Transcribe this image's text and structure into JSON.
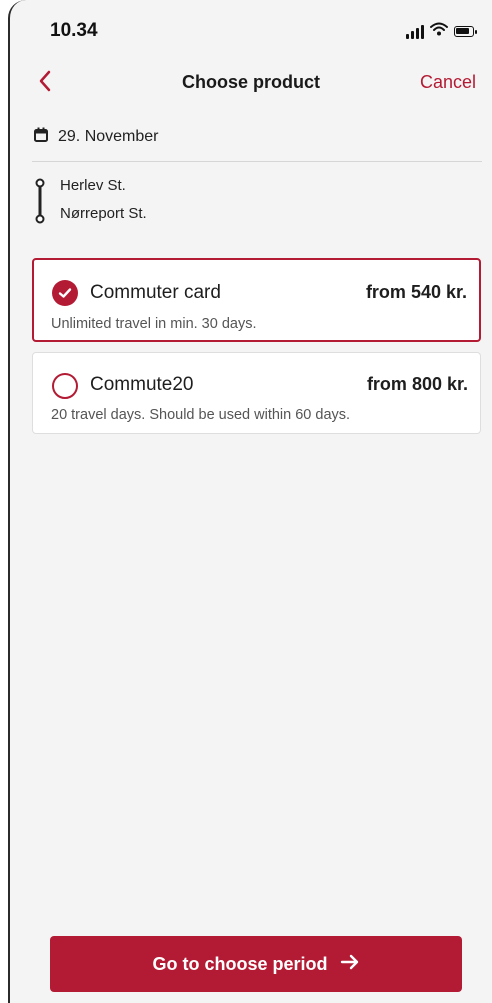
{
  "status_bar": {
    "time": "10.34",
    "icons": [
      "signal-icon",
      "wifi-icon",
      "battery-icon"
    ]
  },
  "header": {
    "back_icon": "chevron-left-icon",
    "title": "Choose product",
    "cancel_label": "Cancel"
  },
  "trip": {
    "date_icon": "calendar-icon",
    "date": "29. November",
    "route_icon": "route-icon",
    "from": "Herlev St.",
    "to": "Nørreport St."
  },
  "products": [
    {
      "name": "Commuter card",
      "price": "from 540 kr.",
      "description": "Unlimited travel in min. 30 days.",
      "selected": true
    },
    {
      "name": "Commute20",
      "price": "from 800 kr.",
      "description": "20 travel days. Should be used within 60 days.",
      "selected": false
    }
  ],
  "footer": {
    "cta_label": "Go to choose period",
    "cta_icon": "arrow-right-icon"
  },
  "colors": {
    "accent": "#b31b34",
    "background": "#f4f4f4",
    "card": "#ffffff",
    "text": "#1e1e1e",
    "muted_text": "#555555"
  }
}
